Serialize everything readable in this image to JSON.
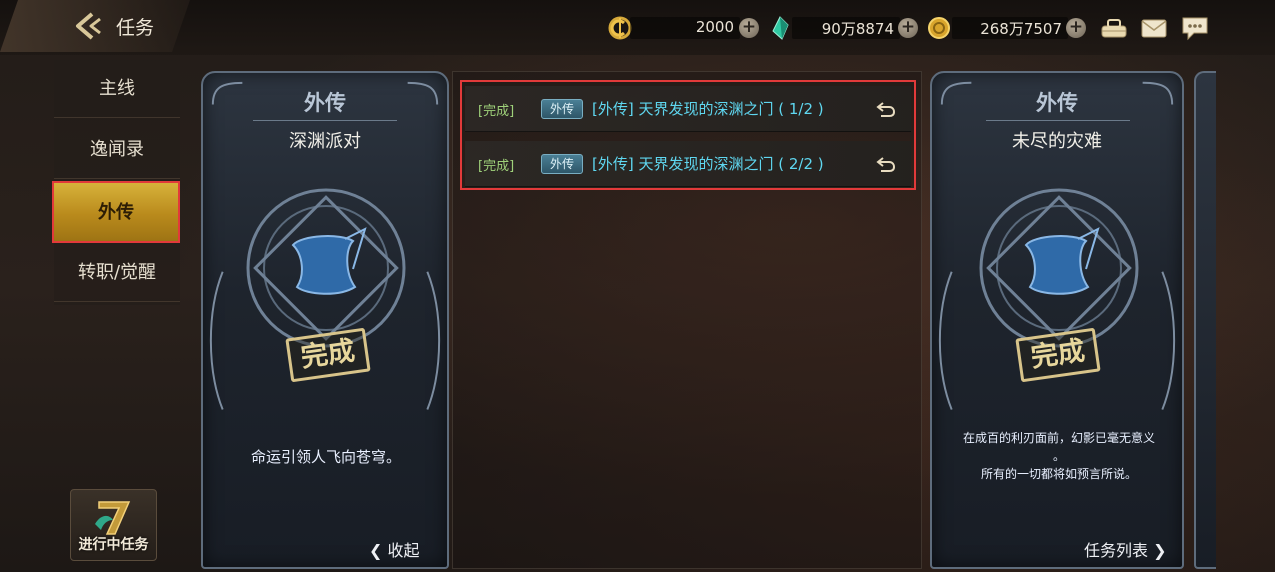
{
  "header": {
    "title": "任务",
    "currencies": [
      {
        "icon": "c-coin-icon",
        "value": "2000"
      },
      {
        "icon": "crystal-icon",
        "value": "90万8874"
      },
      {
        "icon": "gold-coin-icon",
        "value": "268万7507"
      }
    ],
    "icons": [
      "bag-icon",
      "mail-icon",
      "chat-icon"
    ]
  },
  "sidebar": {
    "items": [
      {
        "label": "主线",
        "active": false
      },
      {
        "label": "逸闻录",
        "active": false
      },
      {
        "label": "外传",
        "active": true
      },
      {
        "label": "转职/觉醒",
        "active": false
      }
    ],
    "in_progress_label": "进行中任务"
  },
  "cards": [
    {
      "kind": "外传",
      "name": "深渊派对",
      "stamp": "完成",
      "desc": "命运引领人飞向苍穹。",
      "footer": "收起"
    },
    {
      "kind": "外传",
      "name": "未尽的灾难",
      "stamp": "完成",
      "desc_line1": "在成百的利刃面前，幻影已毫无意义",
      "desc_line2": "。",
      "desc_line3": "所有的一切都将如预言所说。",
      "footer": "任务列表"
    }
  ],
  "quests": [
    {
      "status": "[完成]",
      "tag": "外传",
      "title": "[外传] 天界发现的深渊之门 ( 1/2 )"
    },
    {
      "status": "[完成]",
      "tag": "外传",
      "title": "[外传] 天界发现的深渊之门 ( 2/2 )"
    }
  ],
  "colors": {
    "highlight_border": "#e23a3a",
    "active_tab": "#d7b23a",
    "quest_title": "#5fd7f0",
    "quest_status": "#9fd17a"
  }
}
